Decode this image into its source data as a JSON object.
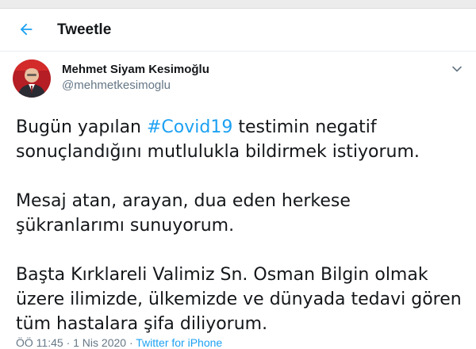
{
  "header": {
    "title": "Tweetle",
    "back_icon": "arrow-left-icon",
    "accent_color": "#1da1f2"
  },
  "tweet": {
    "author_name": "Mehmet Siyam Kesimoğlu",
    "author_handle": "@mehmetkesimoglu",
    "menu_icon": "chevron-down-icon",
    "para1_before": "Bugün yapılan ",
    "para1_hashtag": "#Covid19",
    "para1_after": " testimin negatif sonuçlandığını mutlulukla bildirmek istiyorum.",
    "para2": "Mesaj atan, arayan, dua eden herkese şükranlarımı sunuyorum.",
    "para3": "Başta Kırklareli Valimiz Sn. Osman Bilgin olmak üzere ilimizde, ülkemizde ve dünyada tedavi gören tüm hastalara şifa diliyorum.",
    "time": "ÖÖ 11:45",
    "date": "1 Nis 2020",
    "separator": "·",
    "source": "Twitter for iPhone"
  }
}
